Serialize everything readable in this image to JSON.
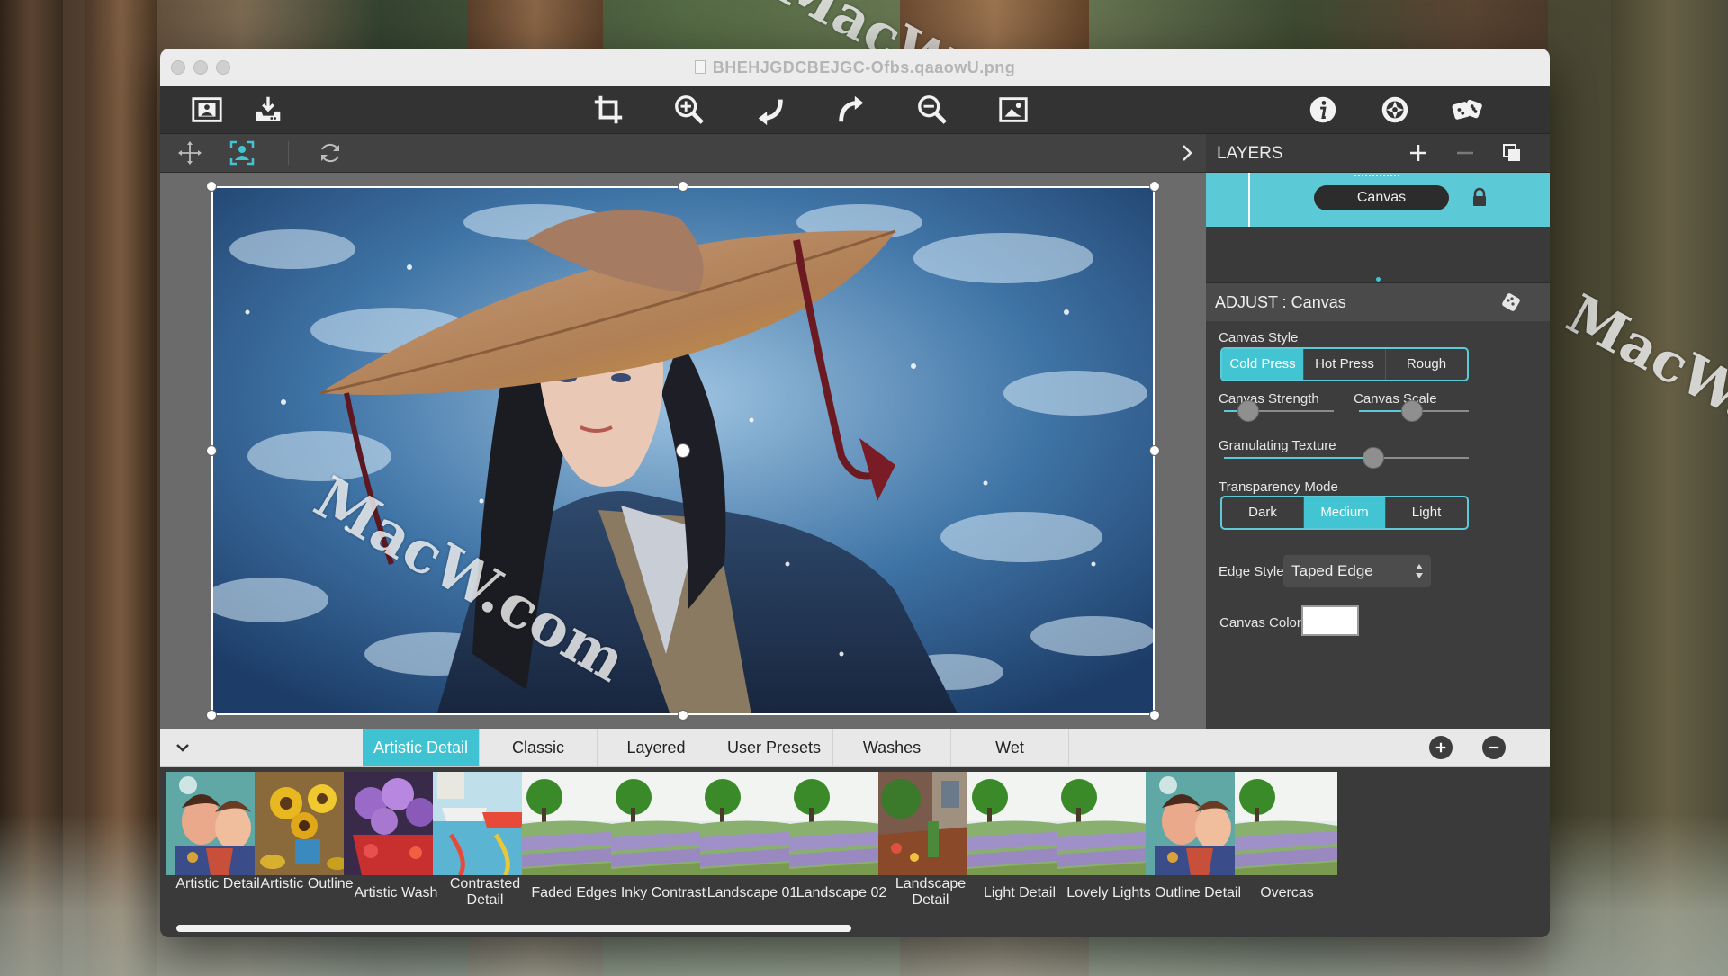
{
  "window": {
    "title": "BHEHJGDCBEJGC-Ofbs.qaaowU.png"
  },
  "watermark": {
    "text": "MacW.com"
  },
  "toolbar": {
    "left_icons": [
      "image-frame-icon",
      "save-download-icon"
    ],
    "center_icons": [
      "crop-icon",
      "zoom-in-icon",
      "undo-icon",
      "redo-icon",
      "zoom-out-icon",
      "fit-image-icon"
    ],
    "right_icons": [
      "info-icon",
      "aperture-icon",
      "dice-icon"
    ]
  },
  "subbar": {
    "icons": [
      "move-arrows-icon",
      "select-person-icon",
      "rotate-refresh-icon",
      "collapse-chevron-icon"
    ]
  },
  "layers": {
    "title": "LAYERS",
    "items": [
      {
        "name": "Canvas",
        "locked": true
      }
    ]
  },
  "adjust": {
    "title": "ADJUST : Canvas",
    "canvas_style": {
      "label": "Canvas Style",
      "options": [
        "Cold Press",
        "Hot Press",
        "Rough"
      ],
      "selected": "Cold Press"
    },
    "canvas_strength": {
      "label": "Canvas Strength",
      "value": 0.22
    },
    "canvas_scale": {
      "label": "Canvas Scale",
      "value": 0.48
    },
    "granulating_texture": {
      "label": "Granulating Texture",
      "value": 0.61
    },
    "transparency_mode": {
      "label": "Transparency Mode",
      "options": [
        "Dark",
        "Medium",
        "Light"
      ],
      "selected": "Medium"
    },
    "edge_style": {
      "label": "Edge Style",
      "value": "Taped Edge"
    },
    "canvas_color": {
      "label": "Canvas Color",
      "value": "#ffffff"
    }
  },
  "preset_tabs": {
    "tabs": [
      "Artistic Detail",
      "Classic",
      "Layered",
      "User Presets",
      "Washes",
      "Wet"
    ],
    "selected": "Artistic Detail"
  },
  "presets": [
    {
      "label": "Artistic Detail",
      "scene": "portrait"
    },
    {
      "label": "Artistic Outline",
      "scene": "sunflower"
    },
    {
      "label": "Artistic Wash",
      "scene": "lilac"
    },
    {
      "label": "Contrasted Detail",
      "scene": "boats"
    },
    {
      "label": "Faded Edges",
      "scene": "landscape"
    },
    {
      "label": "Inky Contrast",
      "scene": "landscape"
    },
    {
      "label": "Landscape 01",
      "scene": "landscape"
    },
    {
      "label": "Landscape 02",
      "scene": "landscape"
    },
    {
      "label": "Landscape Detail",
      "scene": "garden"
    },
    {
      "label": "Light Detail",
      "scene": "landscape"
    },
    {
      "label": "Lovely Lights",
      "scene": "landscape"
    },
    {
      "label": "Outline Detail",
      "scene": "portrait"
    },
    {
      "label": "Overcas",
      "scene": "landscape"
    }
  ],
  "colors": {
    "accent": "#43c4d2",
    "panel": "#3d3d3d",
    "titlebar": "#ececec"
  }
}
